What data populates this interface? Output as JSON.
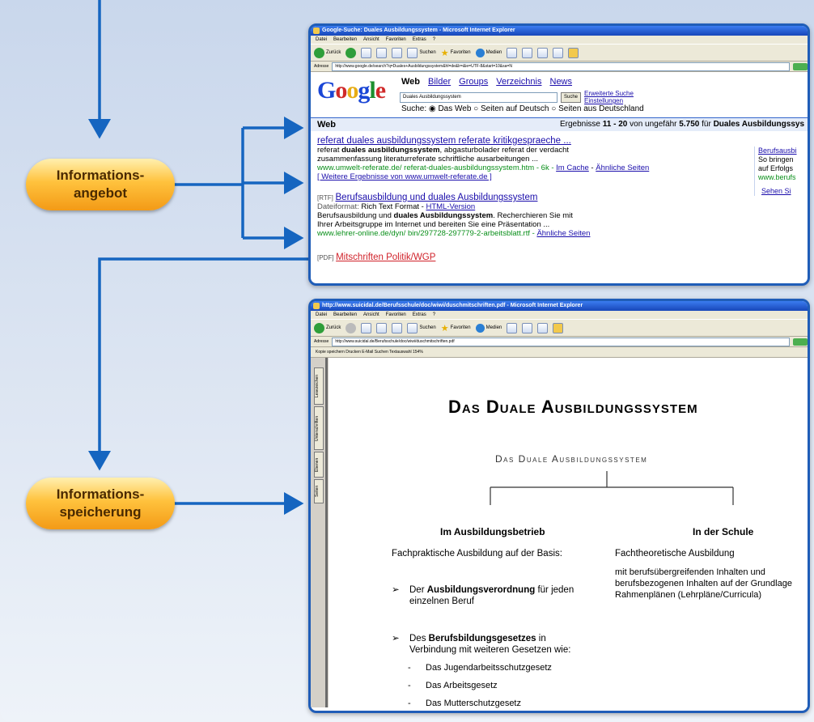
{
  "labels": {
    "angebot_1": "Informations-",
    "angebot_2": "angebot",
    "speicherung_1": "Informations-",
    "speicherung_2": "speicherung"
  },
  "win1": {
    "title": "Google-Suche: Duales Ausbildungssystem - Microsoft Internet Explorer",
    "menu": [
      "Datei",
      "Bearbeiten",
      "Ansicht",
      "Favoriten",
      "Extras",
      "?"
    ],
    "toolbar": {
      "back": "Zurück",
      "search": "Suchen",
      "favorites": "Favoriten",
      "media": "Medien"
    },
    "address_label": "Adresse",
    "address": "http://www.google.de/search?q=Duales+Ausbildungssystem&hl=de&lr=&ie=UTF-8&start=10&sa=N",
    "address_go": "Wechseln",
    "google": {
      "logo": [
        "G",
        "o",
        "o",
        "g",
        "l",
        "e"
      ],
      "nav_active": "Web",
      "nav": [
        "Bilder",
        "Groups",
        "Verzeichnis",
        "News"
      ],
      "query": "Duales Ausbildungssystem",
      "search_button": "Suche",
      "link_advanced": "Erweiterte Suche",
      "link_settings": "Einstellungen",
      "radio_label": "Suche:",
      "radio": [
        "Das Web",
        "Seiten auf Deutsch",
        "Seiten aus Deutschland"
      ],
      "bar_left": "Web",
      "bar_right_pre": "Ergebnisse ",
      "bar_range": "11 - 20",
      "bar_mid": " von ungefähr ",
      "bar_count": "5.750",
      "bar_for": " für ",
      "bar_query": "Duales Ausbildungssys",
      "r1": {
        "title": "referat duales ausbildungssystem referate kritikgespraeche ...",
        "l1a": "referat ",
        "l1b": "duales ausbildungssystem",
        "l1c": ", abgasturbolader referat der verdacht",
        "l2": "zusammenfassung literaturreferate schriftliche ausarbeitungen ...",
        "url": "www.umwelt-referate.de/ referat-duales-ausbildungssystem.htm - 6k - ",
        "cache": "Im Cache",
        "sep": " - ",
        "similar": "Ähnliche Seiten",
        "more": "[ Weitere Ergebnisse von www.umwelt-referate.de ]"
      },
      "r2": {
        "tag": "[RTF]",
        "title": "Berufsausbildung und duales Ausbildungssystem",
        "fmt_label": "Dateiformat: ",
        "fmt_value": "Rich Text Format - ",
        "html": "HTML-Version",
        "l1a": "Berufsausbildung und ",
        "l1b": "duales Ausbildungssystem",
        "l1c": ". Recherchieren Sie mit",
        "l2": "Ihrer Arbeitsgruppe im Internet und bereiten Sie eine Präsentation ...",
        "url": "www.lehrer-online.de/dyn/ bin/297728-297779-2-arbeitsblatt.rtf - ",
        "similar": "Ähnliche Seiten"
      },
      "r3": {
        "tag": "[PDF]",
        "title": "Mitschriften Politik/WGP"
      },
      "side": {
        "title": "Berufsausbi",
        "l1": "So bringen",
        "l2": "auf Erfolgs",
        "url": "www.berufs",
        "more": "Sehen Si"
      }
    }
  },
  "win2": {
    "title": "http://www.suicidal.de/Berufsschule/doc/wiwi/duschmitschriften.pdf - Microsoft Internet Explorer",
    "menu": [
      "Datei",
      "Bearbeiten",
      "Ansicht",
      "Favoriten",
      "Extras",
      "?"
    ],
    "address_label": "Adresse",
    "address": "http://www.suicidal.de/Berufsschule/doc/wiwi/duschmitschriften.pdf",
    "pdf_toolbar": "Kopie speichern   Drucken   E-Mail   Suchen   Textauswahl   154%",
    "side_tabs": [
      "Lesezeichen",
      "Unterschriften",
      "Ebenen",
      "Seiten"
    ],
    "doc": {
      "title": "Das Duale Ausbildungssystem",
      "diagram_title": "Das Duale Ausbildungssystem",
      "left_head": "Im Ausbildungsbetrieb",
      "right_head": "In der Schule",
      "left_line": "Fachpraktische Ausbildung auf der Basis:",
      "right_line": "Fachtheoretische Ausbildung",
      "right_p1": "mit berufsübergreifenden Inhalten und",
      "right_p2": "berufsbezogenen Inhalten auf der Grundlage",
      "right_p3": "Rahmenplänen (Lehrpläne/Curricula)",
      "b1_pre": "Der ",
      "b1_bold": "Ausbildungsverordnung",
      "b1_post": " für jeden",
      "b1_l2": "einzelnen Beruf",
      "b2_pre": "Des ",
      "b2_bold": "Berufsbildungsgesetzes",
      "b2_post": " in",
      "b2_l2": "Verbindung mit weiteren Gesetzen wie:",
      "sub": [
        "Das Jugendarbeitsschutzgesetz",
        "Das Arbeitsgesetz",
        "Das Mutterschutzgesetz"
      ]
    }
  },
  "colors": {
    "arrow": "#1565c0",
    "pill_top": "#fff0b0",
    "pill_bottom": "#f39a16",
    "window_border": "#1f5db8"
  }
}
